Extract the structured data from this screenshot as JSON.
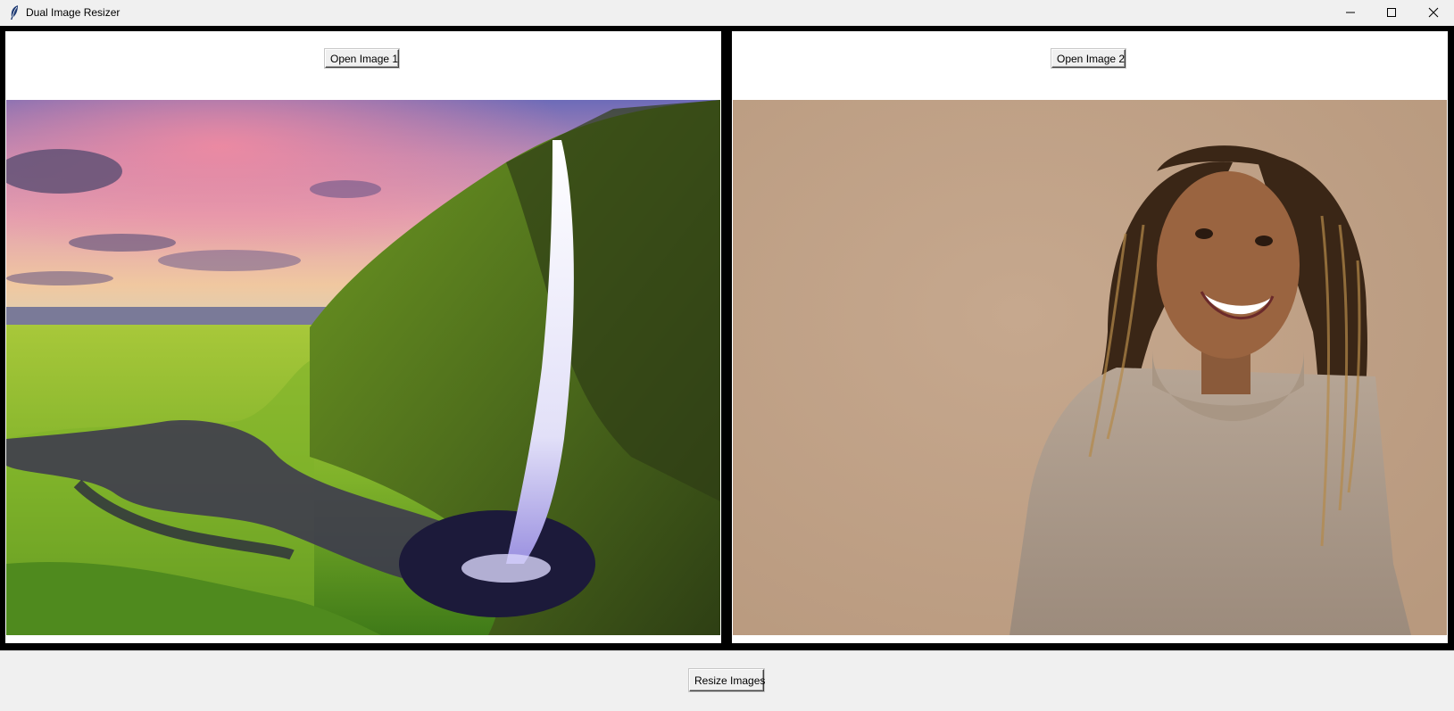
{
  "window": {
    "title": "Dual Image Resizer",
    "app_icon": "feather-icon",
    "controls": {
      "minimize_icon": "minimize-icon",
      "maximize_icon": "maximize-icon",
      "close_icon": "close-icon"
    }
  },
  "panels": [
    {
      "button_label": "Open Image 1",
      "image_description": "waterfall-landscape-photo"
    },
    {
      "button_label": "Open Image 2",
      "image_description": "smiling-girl-portrait-photo"
    }
  ],
  "bottom": {
    "resize_label": "Resize Images"
  },
  "colors": {
    "frame": "#000000",
    "panel_bg": "#ffffff",
    "chrome_bg": "#f0f0f0"
  }
}
